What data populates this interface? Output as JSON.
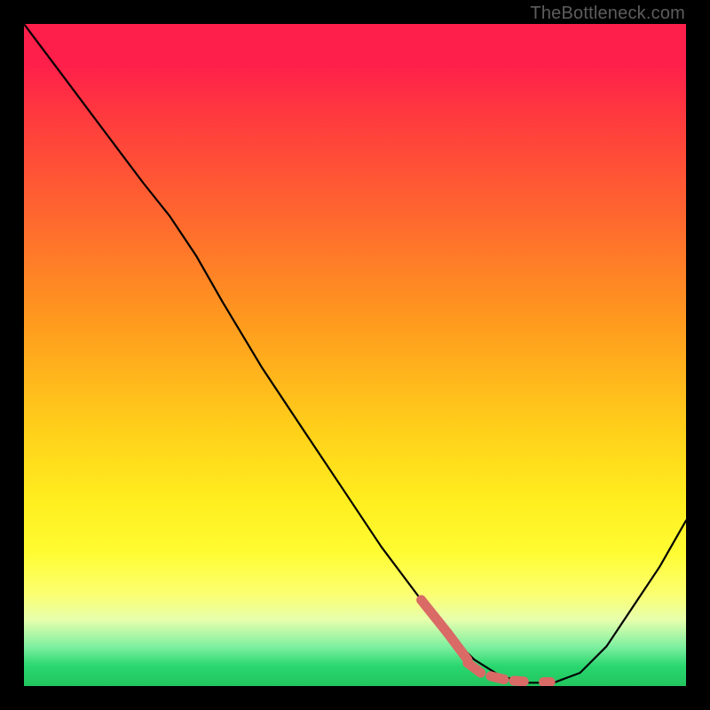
{
  "watermark": "TheBottleneck.com",
  "colors": {
    "frame": "#000000",
    "curve": "#000000",
    "highlight": "#d96a66",
    "gradient_top": "#ff1f4b",
    "gradient_bottom": "#22c55e"
  },
  "chart_data": {
    "type": "line",
    "title": "",
    "xlabel": "",
    "ylabel": "",
    "xlim": [
      0,
      100
    ],
    "ylim": [
      0,
      100
    ],
    "curve": [
      [
        0,
        100
      ],
      [
        6,
        92
      ],
      [
        12,
        84
      ],
      [
        18,
        76
      ],
      [
        22,
        71
      ],
      [
        26,
        65
      ],
      [
        30,
        58
      ],
      [
        36,
        48
      ],
      [
        42,
        39
      ],
      [
        48,
        30
      ],
      [
        54,
        21
      ],
      [
        60,
        13
      ],
      [
        64,
        8
      ],
      [
        68,
        4
      ],
      [
        72,
        1.5
      ],
      [
        76,
        0.5
      ],
      [
        80,
        0.5
      ],
      [
        84,
        2
      ],
      [
        88,
        6
      ],
      [
        92,
        12
      ],
      [
        96,
        18
      ],
      [
        100,
        25
      ]
    ],
    "highlight": {
      "style": "thick-dashes",
      "color": "#d96a66",
      "segments": [
        [
          [
            60,
            13
          ],
          [
            64,
            8
          ]
        ],
        [
          [
            64,
            8
          ],
          [
            67,
            4
          ]
        ],
        [
          [
            67,
            3.5
          ],
          [
            69,
            2
          ]
        ],
        [
          [
            70.5,
            1.5
          ],
          [
            72.5,
            1
          ]
        ],
        [
          [
            74,
            0.8
          ],
          [
            75.5,
            0.7
          ]
        ],
        [
          [
            78.5,
            0.6
          ],
          [
            79.5,
            0.6
          ]
        ]
      ]
    }
  }
}
